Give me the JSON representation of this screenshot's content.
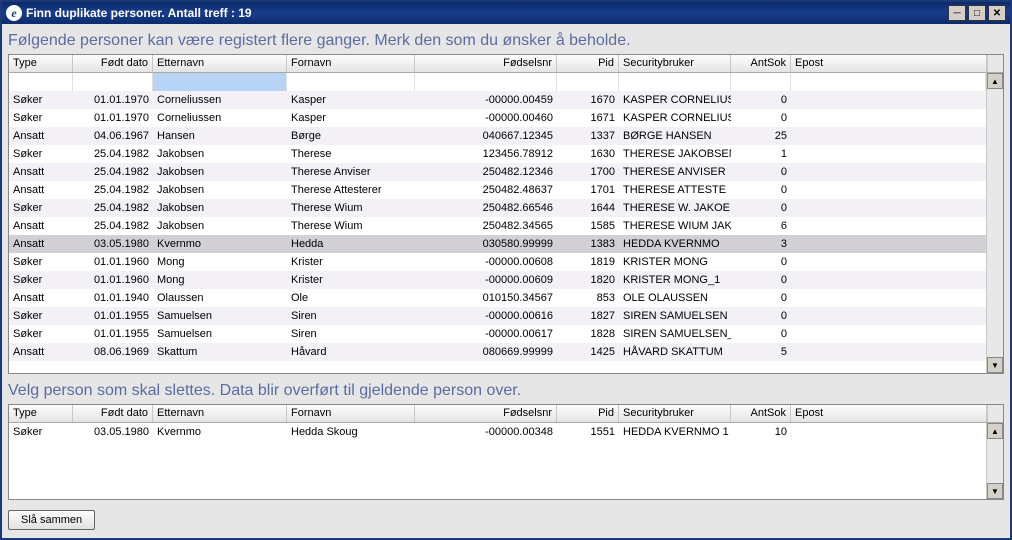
{
  "window": {
    "title": "Finn duplikate personer. Antall treff : 19"
  },
  "topLabel": "Følgende personer kan være registert flere ganger. Merk den som du ønsker å beholde.",
  "bottomLabel": "Velg person som skal slettes. Data blir overført til gjeldende person over.",
  "headers": {
    "type": "Type",
    "dob": "Født dato",
    "last": "Etternavn",
    "first": "Fornavn",
    "fnr": "Fødselsnr",
    "pid": "Pid",
    "sec": "Securitybruker",
    "ant": "AntSok",
    "epost": "Epost"
  },
  "topRows": [
    {
      "type": "Søker",
      "dob": "01.01.1970",
      "last": "Corneliussen",
      "first": "Kasper",
      "fnr": "-00000.00459",
      "pid": "1670",
      "sec": "KASPER CORNELIUS",
      "ant": "0",
      "epost": ""
    },
    {
      "type": "Søker",
      "dob": "01.01.1970",
      "last": "Corneliussen",
      "first": "Kasper",
      "fnr": "-00000.00460",
      "pid": "1671",
      "sec": "KASPER CORNELIUS",
      "ant": "0",
      "epost": ""
    },
    {
      "type": "Ansatt",
      "dob": "04.06.1967",
      "last": "Hansen",
      "first": "Børge",
      "fnr": "040667.12345",
      "pid": "1337",
      "sec": "BØRGE HANSEN",
      "ant": "25",
      "epost": ""
    },
    {
      "type": "Søker",
      "dob": "25.04.1982",
      "last": "Jakobsen",
      "first": "Therese",
      "fnr": "123456.78912",
      "pid": "1630",
      "sec": "THERESE JAKOBSEN",
      "ant": "1",
      "epost": ""
    },
    {
      "type": "Ansatt",
      "dob": "25.04.1982",
      "last": "Jakobsen",
      "first": "Therese Anviser",
      "fnr": "250482.12346",
      "pid": "1700",
      "sec": "THERESE ANVISER",
      "ant": "0",
      "epost": ""
    },
    {
      "type": "Ansatt",
      "dob": "25.04.1982",
      "last": "Jakobsen",
      "first": "Therese Attesterer",
      "fnr": "250482.48637",
      "pid": "1701",
      "sec": "THERESE ATTESTE",
      "ant": "0",
      "epost": ""
    },
    {
      "type": "Søker",
      "dob": "25.04.1982",
      "last": "Jakobsen",
      "first": "Therese Wium",
      "fnr": "250482.66546",
      "pid": "1644",
      "sec": "THERESE W. JAKOE",
      "ant": "0",
      "epost": ""
    },
    {
      "type": "Ansatt",
      "dob": "25.04.1982",
      "last": "Jakobsen",
      "first": "Therese Wium",
      "fnr": "250482.34565",
      "pid": "1585",
      "sec": "THERESE WIUM JAK",
      "ant": "6",
      "epost": ""
    },
    {
      "type": "Ansatt",
      "dob": "03.05.1980",
      "last": "Kvernmo",
      "first": "Hedda",
      "fnr": "030580.99999",
      "pid": "1383",
      "sec": "HEDDA KVERNMO",
      "ant": "3",
      "epost": "",
      "selected": true
    },
    {
      "type": "Søker",
      "dob": "01.01.1960",
      "last": "Mong",
      "first": "Krister",
      "fnr": "-00000.00608",
      "pid": "1819",
      "sec": "KRISTER MONG",
      "ant": "0",
      "epost": ""
    },
    {
      "type": "Søker",
      "dob": "01.01.1960",
      "last": "Mong",
      "first": "Krister",
      "fnr": "-00000.00609",
      "pid": "1820",
      "sec": "KRISTER MONG_1",
      "ant": "0",
      "epost": ""
    },
    {
      "type": "Ansatt",
      "dob": "01.01.1940",
      "last": "Olaussen",
      "first": "Ole",
      "fnr": "010150.34567",
      "pid": "853",
      "sec": "OLE OLAUSSEN",
      "ant": "0",
      "epost": ""
    },
    {
      "type": "Søker",
      "dob": "01.01.1955",
      "last": "Samuelsen",
      "first": "Siren",
      "fnr": "-00000.00616",
      "pid": "1827",
      "sec": "SIREN SAMUELSEN",
      "ant": "0",
      "epost": ""
    },
    {
      "type": "Søker",
      "dob": "01.01.1955",
      "last": "Samuelsen",
      "first": "Siren",
      "fnr": "-00000.00617",
      "pid": "1828",
      "sec": "SIREN SAMUELSEN_",
      "ant": "0",
      "epost": ""
    },
    {
      "type": "Ansatt",
      "dob": "08.06.1969",
      "last": "Skattum",
      "first": "Håvard",
      "fnr": "080669.99999",
      "pid": "1425",
      "sec": "HÅVARD SKATTUM",
      "ant": "5",
      "epost": ""
    }
  ],
  "bottomRows": [
    {
      "type": "Søker",
      "dob": "03.05.1980",
      "last": "Kvernmo",
      "first": "Hedda Skoug",
      "fnr": "-00000.00348",
      "pid": "1551",
      "sec": "HEDDA KVERNMO 1",
      "ant": "10",
      "epost": ""
    }
  ],
  "mergeBtn": "Slå sammen"
}
